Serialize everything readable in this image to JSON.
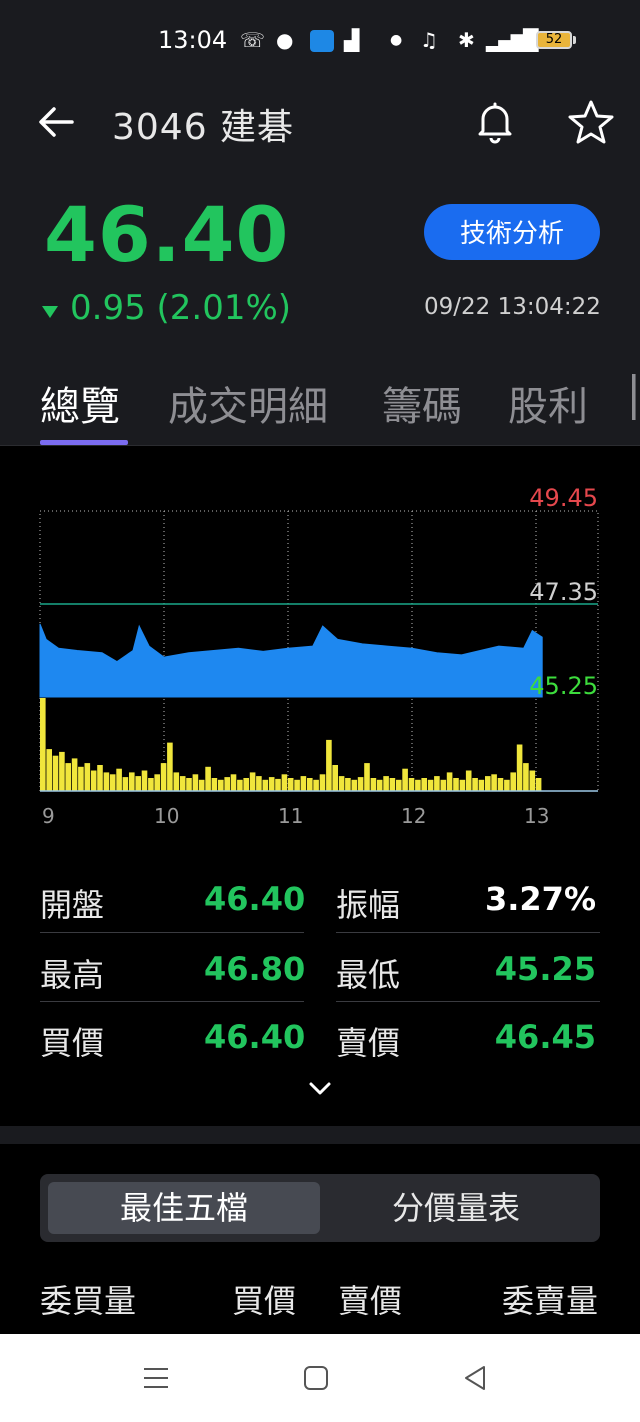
{
  "status_bar": {
    "time": "13:04",
    "battery": "52",
    "icons": [
      "missed-call-icon",
      "wechat-icon",
      "android-icon",
      "signal-chart-icon",
      "dot-icon",
      "mute-icon",
      "bluetooth-icon",
      "signal-icon",
      "battery-icon"
    ]
  },
  "header": {
    "title": "3046 建碁",
    "price": "46.40",
    "change": "0.95 (2.01%)",
    "datetime": "09/22 13:04:22",
    "tech_button": "技術分析",
    "colors": {
      "price": "#22c55e",
      "button": "#1a6cf0",
      "tab_indicator": "#7b6cf0"
    }
  },
  "tabs": [
    {
      "label": "總覽",
      "active": true
    },
    {
      "label": "成交明細",
      "active": false
    },
    {
      "label": "籌碼",
      "active": false
    },
    {
      "label": "股利",
      "active": false
    }
  ],
  "chart_data": {
    "type": "area",
    "y_ticks": [
      {
        "label": "49.45",
        "value": 49.45,
        "color": "#e5484d"
      },
      {
        "label": "47.35",
        "value": 47.35,
        "color": "#d0d0d0"
      },
      {
        "label": "45.25",
        "value": 45.25,
        "color": "#3ddc3d"
      }
    ],
    "ylim": [
      45.25,
      49.45
    ],
    "reference_price": 47.35,
    "x_ticks": [
      "9",
      "10",
      "11",
      "12",
      "13"
    ],
    "price_series": [
      {
        "t": 9.0,
        "v": 46.9
      },
      {
        "t": 9.05,
        "v": 46.55
      },
      {
        "t": 9.15,
        "v": 46.35
      },
      {
        "t": 9.3,
        "v": 46.3
      },
      {
        "t": 9.5,
        "v": 46.25
      },
      {
        "t": 9.62,
        "v": 46.05
      },
      {
        "t": 9.75,
        "v": 46.3
      },
      {
        "t": 9.8,
        "v": 46.85
      },
      {
        "t": 9.88,
        "v": 46.4
      },
      {
        "t": 10.0,
        "v": 46.15
      },
      {
        "t": 10.2,
        "v": 46.25
      },
      {
        "t": 10.4,
        "v": 46.3
      },
      {
        "t": 10.6,
        "v": 46.35
      },
      {
        "t": 10.8,
        "v": 46.28
      },
      {
        "t": 11.0,
        "v": 46.35
      },
      {
        "t": 11.2,
        "v": 46.4
      },
      {
        "t": 11.28,
        "v": 46.85
      },
      {
        "t": 11.4,
        "v": 46.55
      },
      {
        "t": 11.6,
        "v": 46.45
      },
      {
        "t": 11.8,
        "v": 46.4
      },
      {
        "t": 12.0,
        "v": 46.35
      },
      {
        "t": 12.2,
        "v": 46.25
      },
      {
        "t": 12.4,
        "v": 46.2
      },
      {
        "t": 12.55,
        "v": 46.3
      },
      {
        "t": 12.7,
        "v": 46.4
      },
      {
        "t": 12.9,
        "v": 46.35
      },
      {
        "t": 12.97,
        "v": 46.75
      },
      {
        "t": 13.05,
        "v": 46.6
      }
    ],
    "volume_note": "intraday volume bars",
    "volume_series": [
      1.0,
      0.45,
      0.38,
      0.42,
      0.3,
      0.35,
      0.26,
      0.3,
      0.22,
      0.28,
      0.2,
      0.18,
      0.24,
      0.15,
      0.2,
      0.16,
      0.22,
      0.14,
      0.18,
      0.3,
      0.52,
      0.2,
      0.16,
      0.14,
      0.18,
      0.12,
      0.26,
      0.14,
      0.12,
      0.15,
      0.18,
      0.12,
      0.14,
      0.2,
      0.16,
      0.12,
      0.15,
      0.13,
      0.18,
      0.14,
      0.12,
      0.16,
      0.14,
      0.12,
      0.18,
      0.55,
      0.28,
      0.16,
      0.14,
      0.12,
      0.15,
      0.3,
      0.14,
      0.12,
      0.16,
      0.14,
      0.12,
      0.24,
      0.14,
      0.12,
      0.14,
      0.12,
      0.16,
      0.12,
      0.2,
      0.14,
      0.12,
      0.22,
      0.14,
      0.12,
      0.16,
      0.18,
      0.14,
      0.12,
      0.2,
      0.5,
      0.3,
      0.22,
      0.14
    ]
  },
  "stats": [
    {
      "left_label": "開盤",
      "left_value": "46.40",
      "right_label": "振幅",
      "right_value": "3.27%",
      "right_color": "#ffffff"
    },
    {
      "left_label": "最高",
      "left_value": "46.80",
      "right_label": "最低",
      "right_value": "45.25",
      "right_color": "#22c55e"
    },
    {
      "left_label": "買價",
      "left_value": "46.40",
      "right_label": "賣價",
      "right_value": "46.45",
      "right_color": "#22c55e"
    }
  ],
  "segments": {
    "on": "最佳五檔",
    "off": "分價量表"
  },
  "columns": [
    "委買量",
    "買價",
    "賣價",
    "委賣量"
  ]
}
